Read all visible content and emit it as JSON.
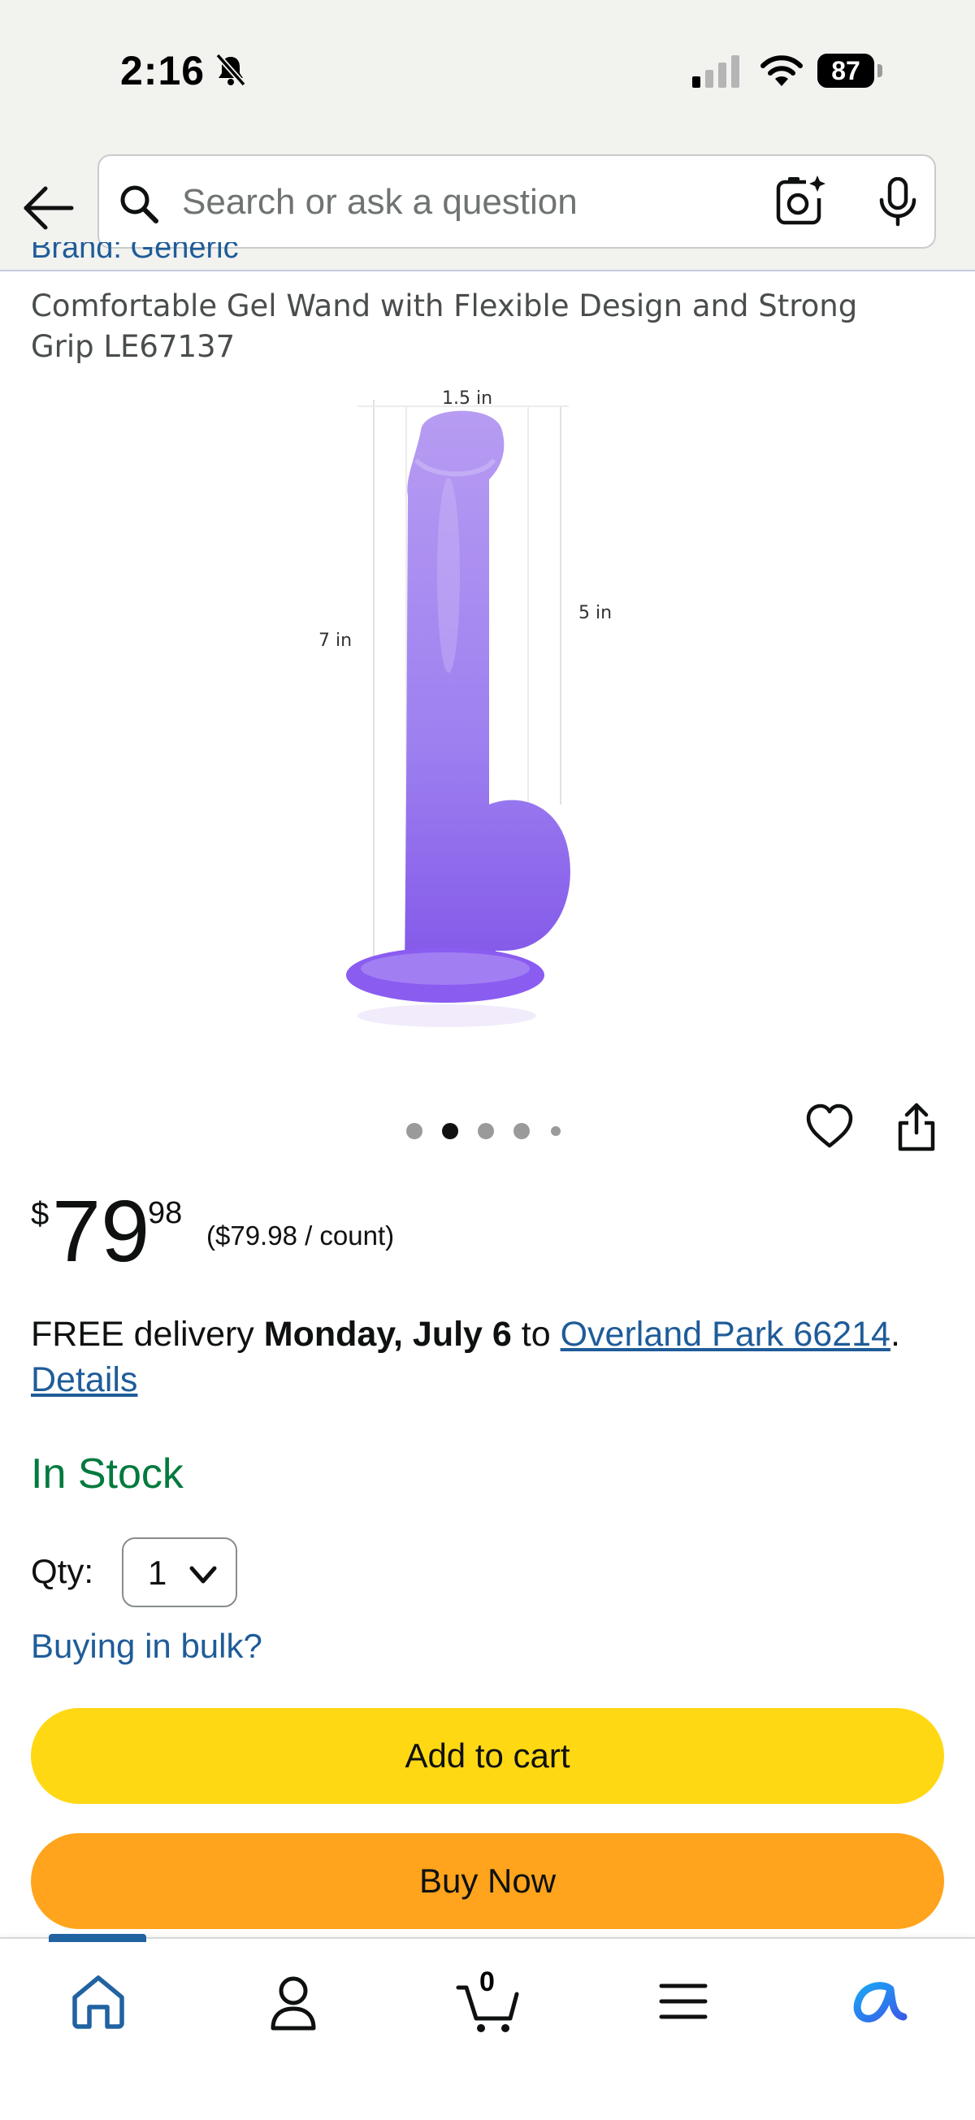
{
  "status_bar": {
    "time": "2:16",
    "battery": "87"
  },
  "search": {
    "placeholder": "Search or ask a question"
  },
  "product": {
    "brand": "Brand: Generic",
    "title": "Comfortable Gel Wand with Flexible Design and Strong Grip LE67137",
    "image_labels": {
      "width": "1.5 in",
      "total_length": "7 in",
      "insertable_length": "5 in"
    },
    "image_count": 5,
    "active_image_index": 1
  },
  "price": {
    "symbol": "$",
    "whole": "79",
    "fraction": "98",
    "unit_price": "($79.98 / count)"
  },
  "delivery": {
    "prefix": "FREE delivery",
    "date": "Monday, July 6",
    "to": "to",
    "location": "Overland Park 66214",
    "period": ".",
    "details_link": "Details"
  },
  "availability": "In Stock",
  "quantity": {
    "label": "Qty:",
    "value": "1"
  },
  "bulk_link": "Buying in bulk?",
  "buttons": {
    "add_to_cart": "Add to cart",
    "buy_now": "Buy Now"
  },
  "bottom_nav": {
    "cart_count": "0",
    "active": "home"
  },
  "colors": {
    "add_to_cart": "#ffd814",
    "buy_now": "#ffa41c",
    "link": "#1f5c99",
    "in_stock": "#007a3d",
    "nav_active": "#2162a1"
  },
  "icons": [
    "bell-slash-icon",
    "signal-icon",
    "wifi-icon",
    "battery-icon",
    "back-arrow-icon",
    "search-icon",
    "camera-lens-icon",
    "microphone-icon",
    "heart-icon",
    "share-icon",
    "chevron-down-icon",
    "home-icon",
    "account-icon",
    "cart-icon",
    "menu-icon",
    "rufus-assistant-icon"
  ]
}
